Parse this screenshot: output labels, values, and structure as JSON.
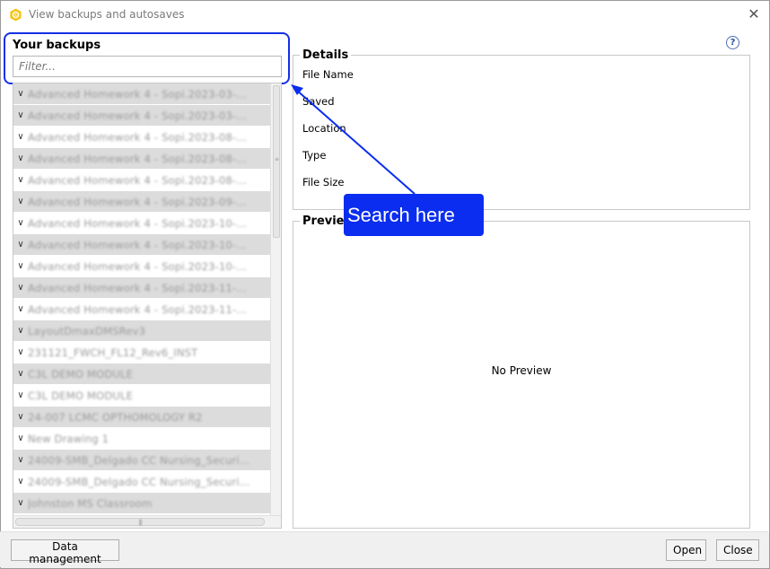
{
  "window": {
    "title": "View backups and autosaves",
    "close_glyph": "✕",
    "app_icon": "hexagon-gear-icon",
    "accent": "#f5c518"
  },
  "left": {
    "title": "Your backups",
    "filter_placeholder": "Filter...",
    "items": [
      {
        "label": "Advanced Homework 4 - Sopi.2023-03-...",
        "shaded": true
      },
      {
        "label": "Advanced Homework 4 - Sopi.2023-03-...",
        "shaded": true
      },
      {
        "label": "Advanced Homework 4 - Sopi.2023-08-...",
        "shaded": false
      },
      {
        "label": "Advanced Homework 4 - Sopi.2023-08-...",
        "shaded": true
      },
      {
        "label": "Advanced Homework 4 - Sopi.2023-08-...",
        "shaded": false
      },
      {
        "label": "Advanced Homework 4 - Sopi.2023-09-...",
        "shaded": true
      },
      {
        "label": "Advanced Homework 4 - Sopi.2023-10-...",
        "shaded": false
      },
      {
        "label": "Advanced Homework 4 - Sopi.2023-10-...",
        "shaded": true
      },
      {
        "label": "Advanced Homework 4 - Sopi.2023-10-...",
        "shaded": false
      },
      {
        "label": "Advanced Homework 4 - Sopi.2023-11-...",
        "shaded": true
      },
      {
        "label": "Advanced Homework 4 - Sopi.2023-11-...",
        "shaded": false
      },
      {
        "label": "LayoutDmaxDMSRev3",
        "shaded": true
      },
      {
        "label": "231121_FWCH_FL12_Rev6_INST",
        "shaded": false
      },
      {
        "label": "C3L DEMO MODULE",
        "shaded": true
      },
      {
        "label": "C3L DEMO MODULE",
        "shaded": false
      },
      {
        "label": "24-007 LCMC OPTHOMOLOGY R2",
        "shaded": true
      },
      {
        "label": "New Drawing 1",
        "shaded": false
      },
      {
        "label": "24009-SMB_Delgado CC Nursing_Securi...",
        "shaded": true
      },
      {
        "label": "24009-SMB_Delgado CC Nursing_Securi...",
        "shaded": false
      },
      {
        "label": "Johnston MS Classroom",
        "shaded": true
      }
    ]
  },
  "details": {
    "legend": "Details",
    "labels": [
      "File Name",
      "Saved",
      "Location",
      "Type",
      "File Size"
    ],
    "help_glyph": "?"
  },
  "preview": {
    "legend": "Preview",
    "empty_text": "No Preview"
  },
  "annotation": {
    "text": "Search here",
    "color": "#0a2df0"
  },
  "footer": {
    "data_management": "Data management",
    "open": "Open",
    "close": "Close"
  }
}
